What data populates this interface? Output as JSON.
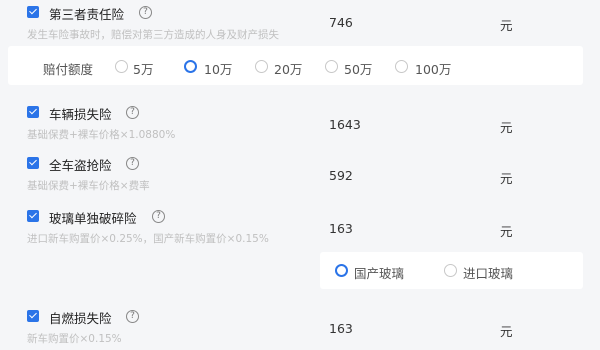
{
  "items": [
    {
      "name": "第三者责任险",
      "desc": "发生车险事故时，赔偿对第三方造成的人身及财产损失",
      "price": "746",
      "unit": "元"
    },
    {
      "name": "车辆损失险",
      "desc": "基础保费+裸车价格×1.0880%",
      "price": "1643",
      "unit": "元"
    },
    {
      "name": "全车盗抢险",
      "desc": "基础保费+裸车价格×费率",
      "price": "592",
      "unit": "元"
    },
    {
      "name": "玻璃单独破碎险",
      "desc": "进口新车购置价×0.25%，国产新车购置价×0.15%",
      "price": "163",
      "unit": "元"
    },
    {
      "name": "自燃损失险",
      "desc": "新车购置价×0.15%",
      "price": "163",
      "unit": "元"
    }
  ],
  "help_glyph": "?",
  "coverage": {
    "label": "赔付额度",
    "options": [
      "5万",
      "10万",
      "20万",
      "50万",
      "100万"
    ],
    "selected": "10万"
  },
  "glass": {
    "options": [
      "国产玻璃",
      "进口玻璃"
    ],
    "selected": "国产玻璃"
  },
  "colors": {
    "accent": "#2b74e8",
    "background": "#f5f6f8",
    "panel": "#ffffff"
  }
}
